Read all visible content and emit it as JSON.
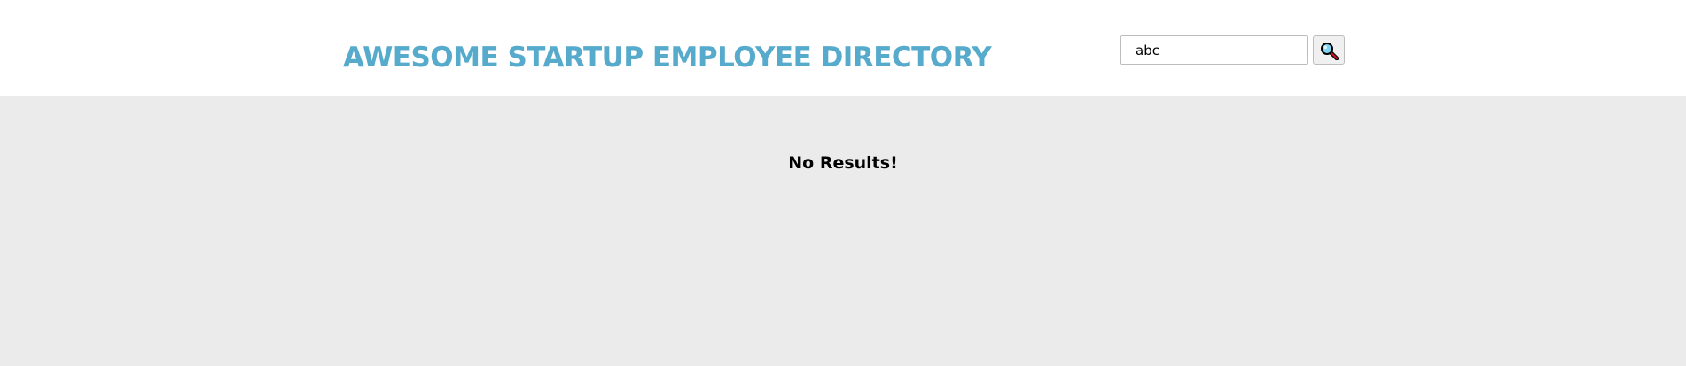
{
  "header": {
    "title": "AWESOME STARTUP EMPLOYEE DIRECTORY"
  },
  "search": {
    "value": "abc",
    "icon": "magnifying-glass-icon"
  },
  "results": {
    "message": "No Results!"
  },
  "colors": {
    "title": "#56abcc",
    "header_background": "#ffffff",
    "content_background": "#ebebeb",
    "message": "#000000"
  }
}
